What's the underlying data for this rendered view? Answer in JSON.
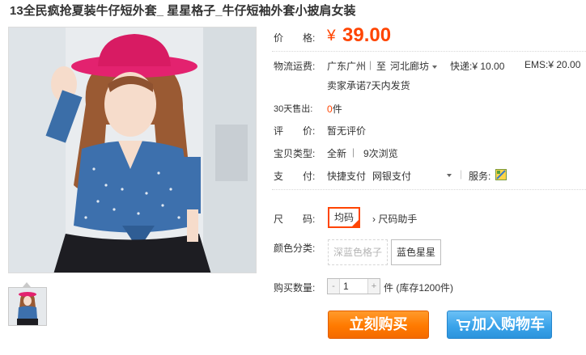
{
  "title": "13全民疯抢夏装牛仔短外套_ 星星格子_牛仔短袖外套小披肩女装",
  "price": {
    "label": "价　　格:",
    "currency": "¥",
    "value": "39.00"
  },
  "shipping": {
    "label": "物流运费:",
    "from": "广东广州",
    "divider": "|",
    "to_prefix": "至",
    "to": "河北廊坊",
    "express": "快递:¥ 10.00",
    "ems": "EMS:¥ 20.00",
    "promise": "卖家承诺7天内发货"
  },
  "sales": {
    "label": "30天售出:",
    "count": "0",
    "unit": "件"
  },
  "reviews": {
    "label": "评　　价:",
    "value": "暂无评价"
  },
  "item_type": {
    "label": "宝贝类型:",
    "condition": "全新",
    "divider": "|",
    "views": "9次浏览"
  },
  "payment": {
    "label": "支　　付:",
    "method1": "快捷支付",
    "method2": "网银支付",
    "service_label": "服务:"
  },
  "size": {
    "label": "尺　　码:",
    "options": [
      "均码"
    ],
    "helper": "› 尺码助手"
  },
  "color": {
    "label": "颜色分类:",
    "options": [
      "深蓝色格子",
      "蓝色星星"
    ]
  },
  "quantity": {
    "label": "购买数量:",
    "value": "1",
    "minus": "-",
    "plus": "+",
    "stock_text": "件 (库存1200件)"
  },
  "buttons": {
    "buy_now": "立刻购买",
    "add_to_cart": "加入购物车"
  },
  "colors": {
    "accent": "#ff4400",
    "buy": "#ff7a00",
    "cart": "#3ba4ea"
  }
}
